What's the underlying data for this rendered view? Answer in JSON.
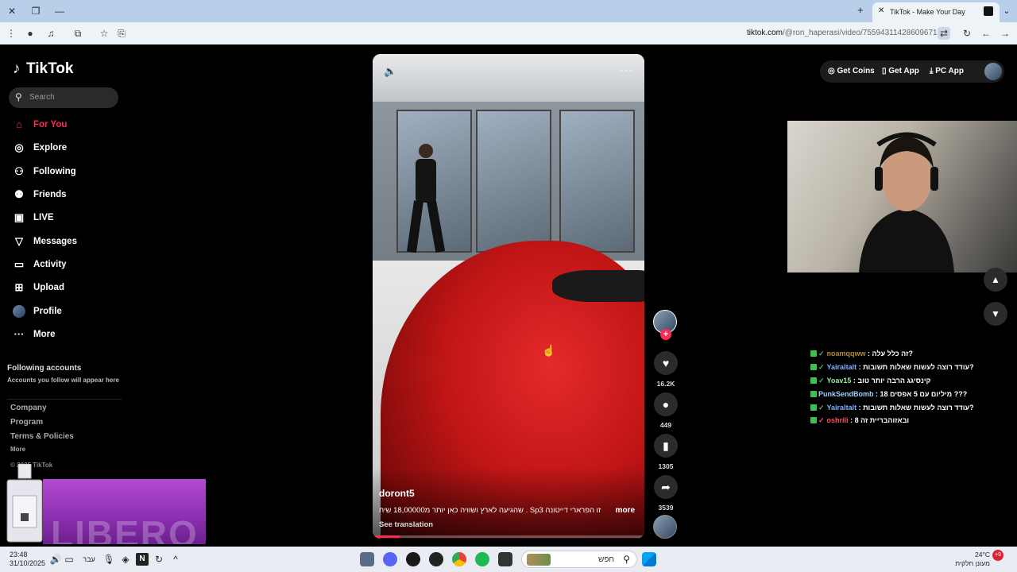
{
  "browser": {
    "tab_title": "TikTok - Make Your Day",
    "url_host": "tiktok.com",
    "url_path": "/@ron_haperasi/video/7559431142860967175"
  },
  "sidebar": {
    "logo": "TikTok",
    "search_placeholder": "Search",
    "nav": [
      {
        "label": "For You",
        "icon": "home-icon",
        "active": true
      },
      {
        "label": "Explore",
        "icon": "compass-icon"
      },
      {
        "label": "Following",
        "icon": "user-follow-icon"
      },
      {
        "label": "Friends",
        "icon": "friends-icon"
      },
      {
        "label": "LIVE",
        "icon": "live-icon"
      },
      {
        "label": "Messages",
        "icon": "send-icon"
      },
      {
        "label": "Activity",
        "icon": "activity-icon"
      },
      {
        "label": "Upload",
        "icon": "upload-icon"
      },
      {
        "label": "Profile",
        "icon": "avatar-icon"
      },
      {
        "label": "More",
        "icon": "more-dots-icon"
      }
    ],
    "following_title": "Following accounts",
    "following_sub": "Accounts you follow will appear here",
    "footer": [
      "Company",
      "Program",
      "Terms & Policies"
    ],
    "footer_more": "More",
    "copyright": "© 2025 TikTok",
    "promo_word": "LIBERO"
  },
  "video": {
    "username": "doront5",
    "caption": "שהגיעה לארץ ושוויה כאן יותר מ18,00000 שיח . Sp3 זו הפרארי דייטונה",
    "more": "more",
    "translation": "See translation",
    "progress": 0.1
  },
  "actions": {
    "likes": "16.2K",
    "comments": "449",
    "saves": "1305",
    "shares": "3539"
  },
  "header": {
    "get_coins": "Get Coins",
    "get_app": "Get App",
    "pc_app": "PC App"
  },
  "chat": [
    {
      "user": "noamqqww",
      "text": "זה כלל עלה?",
      "color": "#b5893a"
    },
    {
      "user": "Yairaltalt",
      "text": "עודד רוצה לעשות שאלות תשובות?",
      "color": "#7fb0ff"
    },
    {
      "user": "Yoav15",
      "text": "קינסיגג הרבה יותר טוב",
      "color": "#9fe3a9"
    },
    {
      "user": "PunkSendBomb",
      "text": "מיליום עם 5 אפסים 18 ???",
      "color": "#9fd0ff"
    },
    {
      "user": "Yairaltalt",
      "text": "עודד רוצה לעשות שאלות תשובות?",
      "color": "#7fb0ff"
    },
    {
      "user": "oshrili",
      "text": "ובאזוהבריית זה 8",
      "color": "#ff4d6a"
    }
  ],
  "taskbar": {
    "time": "23:48",
    "date": "31/10/2025",
    "lang": "עבר",
    "search_placeholder": "חפש",
    "temp": "24°C",
    "weather": "מעונן חלקית",
    "badge": "+9"
  }
}
